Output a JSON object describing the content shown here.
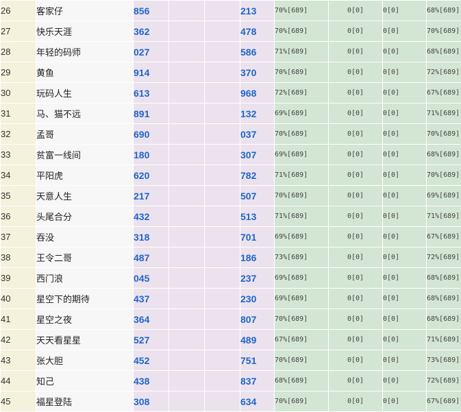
{
  "rows": [
    {
      "rank": "26",
      "name": "客家仔",
      "num_a": "856",
      "num_b": "213",
      "s1": "70%[689]",
      "s2": "0[0]",
      "s3": "0[0]",
      "s4": "68%[689]"
    },
    {
      "rank": "27",
      "name": "快乐天涯",
      "num_a": "362",
      "num_b": "478",
      "s1": "70%[689]",
      "s2": "0[0]",
      "s3": "0[0]",
      "s4": "70%[689]"
    },
    {
      "rank": "28",
      "name": "年轻的码师",
      "num_a": "027",
      "num_b": "586",
      "s1": "71%[689]",
      "s2": "0[0]",
      "s3": "0[0]",
      "s4": "68%[689]"
    },
    {
      "rank": "29",
      "name": "黄鱼",
      "num_a": "914",
      "num_b": "370",
      "s1": "70%[689]",
      "s2": "0[0]",
      "s3": "0[0]",
      "s4": "72%[689]"
    },
    {
      "rank": "30",
      "name": "玩码人生",
      "num_a": "613",
      "num_b": "968",
      "s1": "72%[689]",
      "s2": "0[0]",
      "s3": "0[0]",
      "s4": "67%[689]"
    },
    {
      "rank": "31",
      "name": "马、猫不远",
      "num_a": "891",
      "num_b": "132",
      "s1": "69%[689]",
      "s2": "0[0]",
      "s3": "0[0]",
      "s4": "71%[689]"
    },
    {
      "rank": "32",
      "name": "孟哥",
      "num_a": "690",
      "num_b": "037",
      "s1": "70%[689]",
      "s2": "0[0]",
      "s3": "0[0]",
      "s4": "70%[689]"
    },
    {
      "rank": "33",
      "name": "贫富一线间",
      "num_a": "180",
      "num_b": "307",
      "s1": "69%[689]",
      "s2": "0[0]",
      "s3": "0[0]",
      "s4": "68%[689]"
    },
    {
      "rank": "34",
      "name": "平阳虎",
      "num_a": "620",
      "num_b": "782",
      "s1": "71%[689]",
      "s2": "0[0]",
      "s3": "0[0]",
      "s4": "70%[689]"
    },
    {
      "rank": "35",
      "name": "天意人生",
      "num_a": "217",
      "num_b": "507",
      "s1": "70%[689]",
      "s2": "0[0]",
      "s3": "0[0]",
      "s4": "69%[689]"
    },
    {
      "rank": "36",
      "name": "头尾合分",
      "num_a": "432",
      "num_b": "513",
      "s1": "71%[689]",
      "s2": "0[0]",
      "s3": "0[0]",
      "s4": "71%[689]"
    },
    {
      "rank": "37",
      "name": "吞没",
      "num_a": "318",
      "num_b": "701",
      "s1": "69%[689]",
      "s2": "0[0]",
      "s3": "0[0]",
      "s4": "67%[689]"
    },
    {
      "rank": "38",
      "name": "王令二哥",
      "num_a": "487",
      "num_b": "186",
      "s1": "73%[689]",
      "s2": "0[0]",
      "s3": "0[0]",
      "s4": "72%[689]"
    },
    {
      "rank": "39",
      "name": "西门浪",
      "num_a": "045",
      "num_b": "237",
      "s1": "69%[689]",
      "s2": "0[0]",
      "s3": "0[0]",
      "s4": "68%[689]"
    },
    {
      "rank": "40",
      "name": "星空下的期待",
      "num_a": "437",
      "num_b": "230",
      "s1": "69%[689]",
      "s2": "0[0]",
      "s3": "0[0]",
      "s4": "68%[689]"
    },
    {
      "rank": "41",
      "name": "星空之夜",
      "num_a": "364",
      "num_b": "807",
      "s1": "70%[689]",
      "s2": "0[0]",
      "s3": "0[0]",
      "s4": "68%[689]"
    },
    {
      "rank": "42",
      "name": "天天看星星",
      "num_a": "527",
      "num_b": "489",
      "s1": "67%[689]",
      "s2": "0[0]",
      "s3": "0[0]",
      "s4": "71%[689]"
    },
    {
      "rank": "43",
      "name": "张大胆",
      "num_a": "452",
      "num_b": "751",
      "s1": "70%[689]",
      "s2": "0[0]",
      "s3": "0[0]",
      "s4": "73%[689]"
    },
    {
      "rank": "44",
      "name": "知己",
      "num_a": "438",
      "num_b": "837",
      "s1": "68%[689]",
      "s2": "0[0]",
      "s3": "0[0]",
      "s4": "72%[689]"
    },
    {
      "rank": "45",
      "name": "福星登陆",
      "num_a": "308",
      "num_b": "634",
      "s1": "70%[689]",
      "s2": "0[0]",
      "s3": "0[0]",
      "s4": "67%[689]"
    }
  ]
}
